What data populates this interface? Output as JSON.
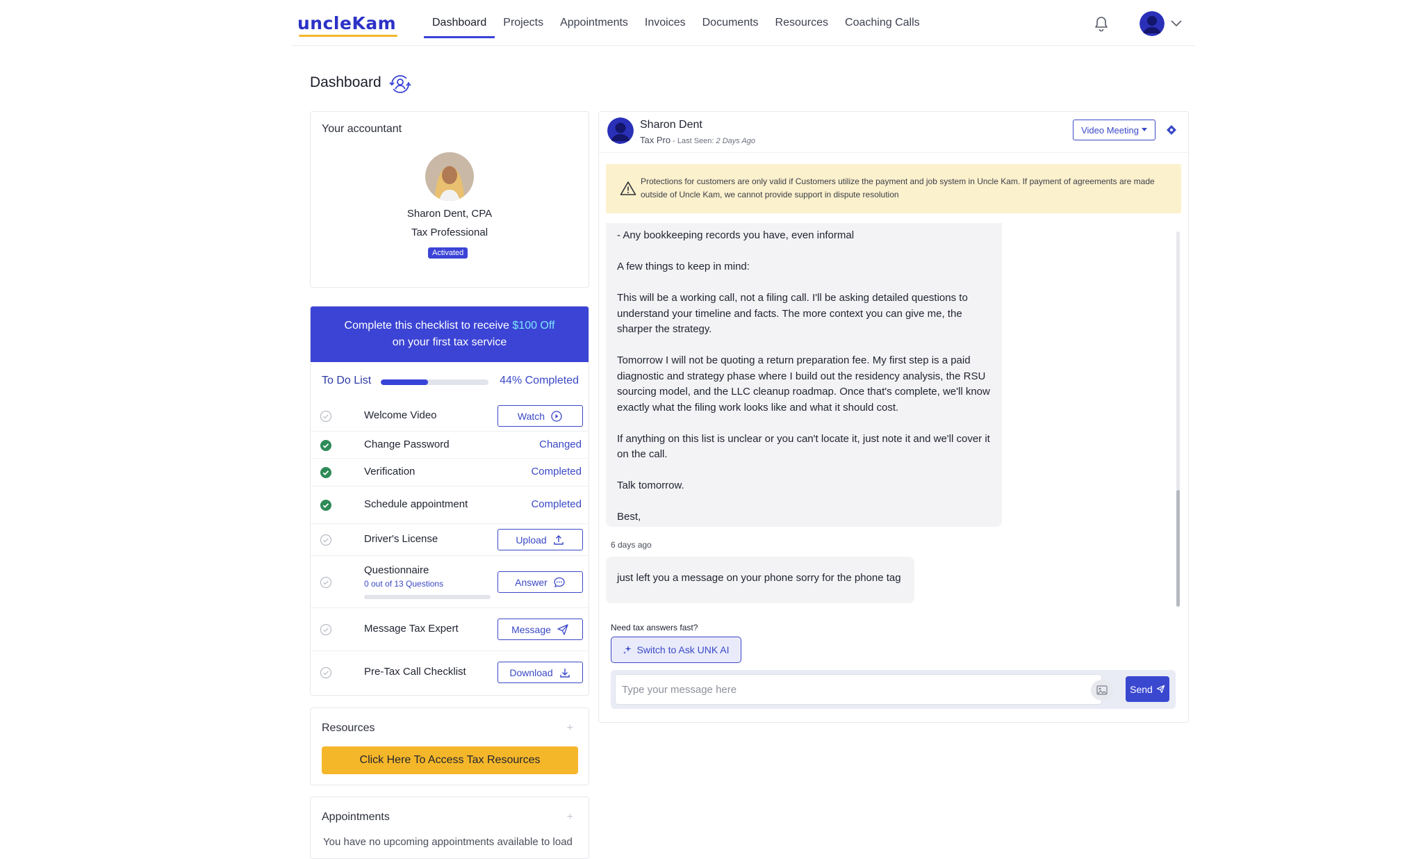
{
  "brand": {
    "logo_text": "uncleKam"
  },
  "nav": {
    "items": [
      {
        "label": "Dashboard",
        "active": true
      },
      {
        "label": "Projects"
      },
      {
        "label": "Appointments"
      },
      {
        "label": "Invoices"
      },
      {
        "label": "Documents"
      },
      {
        "label": "Resources"
      },
      {
        "label": "Coaching Calls"
      }
    ],
    "icons": [
      "bell-icon",
      "user-avatar",
      "chevron-down-icon"
    ]
  },
  "page": {
    "title": "Dashboard"
  },
  "accountant": {
    "heading": "Your accountant",
    "name": "Sharon Dent, CPA",
    "role": "Tax Professional",
    "status_badge": "Activated"
  },
  "checklist": {
    "promo_prefix": "Complete this checklist to receive ",
    "promo_highlight": "$100 Off",
    "promo_suffix": "on your first tax service",
    "title": "To Do List",
    "progress_value": 0.44,
    "progress_label": "44% Completed",
    "items": [
      {
        "label": "Welcome Video",
        "done": false,
        "action": "Watch"
      },
      {
        "label": "Change Password",
        "done": true,
        "status": "Changed"
      },
      {
        "label": "Verification",
        "done": true,
        "status": "Completed"
      },
      {
        "label": "Schedule appointment",
        "done": true,
        "status": "Completed"
      },
      {
        "label": "Driver's License",
        "done": false,
        "action": "Upload"
      },
      {
        "label": "Questionnaire",
        "sub": "0 out of 13 Questions",
        "done": false,
        "action": "Answer",
        "progress_value": 0
      },
      {
        "label": "Message Tax Expert",
        "done": false,
        "action": "Message"
      },
      {
        "label": "Pre-Tax Call Checklist",
        "done": false,
        "action": "Download"
      }
    ]
  },
  "resources": {
    "heading": "Resources",
    "toggle": "+",
    "button": "Click Here To Access Tax Resources"
  },
  "appointments": {
    "heading": "Appointments",
    "toggle": "+",
    "empty_text": "You have no upcoming appointments available to load"
  },
  "chat": {
    "contact_name": "Sharon Dent",
    "contact_role": "Tax Pro",
    "last_seen_label": " - Last Seen: ",
    "last_seen_value": "2 Days Ago",
    "video_button": "Video Meeting",
    "warning": "Protections for customers are only valid if Customers utilize the payment and job system in Uncle Kam. If payment of agreements are made outside of Uncle Kam, we cannot provide support in dispute resolution",
    "messages": [
      {
        "paragraphs": [
          "- Any bookkeeping records you have, even informal",
          "A few things to keep in mind:",
          "This will be a working call, not a filing call. I'll be asking detailed questions to understand your timeline and facts. The more context you can give me, the sharper the strategy.",
          "Tomorrow I will not be quoting a return preparation fee. My first step is a paid diagnostic and strategy phase where I build out the residency analysis, the RSU sourcing model, and the LLC cleanup roadmap. Once that's complete, we'll know exactly what the filing work looks like and what it should cost.",
          "If anything on this list is unclear or you can't locate it, just note it and we'll cover it on the call.",
          "Talk tomorrow.",
          "Best,"
        ]
      },
      {
        "time": "6 days ago",
        "text": "just left you a message on your phone sorry for the phone tag"
      }
    ],
    "ai_prompt": "Need tax answers fast?",
    "ai_button": "Switch to Ask UNK AI",
    "input_placeholder": "Type your message here",
    "send_label": "Send"
  },
  "colors": {
    "primary": "#3843d8",
    "accent_yellow": "#f5b72a",
    "warning_bg": "#fcf1cd",
    "success": "#2e8b57"
  }
}
